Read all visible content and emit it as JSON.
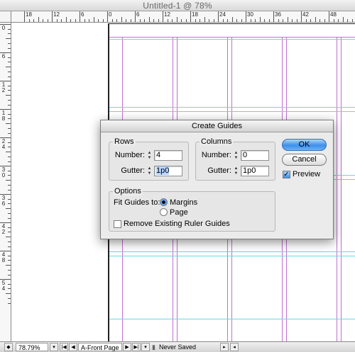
{
  "window": {
    "title": "Untitled-1 @ 78%"
  },
  "ruler": {
    "h_labels": [
      "18",
      "12",
      "6",
      "0",
      "6",
      "12",
      "18",
      "24",
      "30",
      "36",
      "42",
      "48"
    ],
    "v_labels": [
      "0",
      "6",
      "1 2",
      "1 8",
      "2 4",
      "3 0",
      "3 6",
      "4 2",
      "4 8",
      "5 4"
    ]
  },
  "dialog": {
    "title": "Create Guides",
    "rows": {
      "label": "Rows",
      "number_label": "Number:",
      "number_value": "4",
      "gutter_label": "Gutter:",
      "gutter_value": "1p0"
    },
    "columns": {
      "label": "Columns",
      "number_label": "Number:",
      "number_value": "0",
      "gutter_label": "Gutter:",
      "gutter_value": "1p0"
    },
    "options": {
      "label": "Options",
      "fit_label": "Fit Guides to:",
      "margins_label": "Margins",
      "margins_selected": true,
      "page_label": "Page",
      "page_selected": false,
      "remove_label": "Remove Existing Ruler Guides",
      "remove_checked": false
    },
    "ok_label": "OK",
    "cancel_label": "Cancel",
    "preview_label": "Preview",
    "preview_checked": true
  },
  "status": {
    "zoom": "78.79%",
    "page": "A-Front Page",
    "save_state": "Never Saved"
  },
  "colors": {
    "margin_guide": "#c070d0",
    "ruler_guide": "#68d8e0",
    "accent": "#3f8fe6"
  }
}
